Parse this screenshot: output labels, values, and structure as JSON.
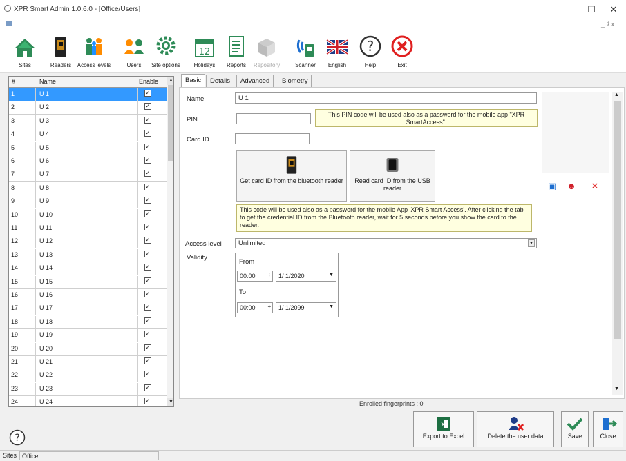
{
  "window": {
    "title": "XPR Smart Admin 1.0.6.0 - [Office/Users]",
    "min_glyph": "—",
    "max_glyph": "☐",
    "close_glyph": "✕",
    "mdi_controls": "_ ₫ x"
  },
  "toolbar": [
    {
      "key": "sites",
      "label": "Sites",
      "icon": "house-icon",
      "enabled": true
    },
    {
      "key": "readers",
      "label": "Readers",
      "icon": "reader-icon",
      "enabled": true
    },
    {
      "key": "access_levels",
      "label": "Access levels",
      "icon": "people-icon",
      "enabled": true
    },
    {
      "key": "users",
      "label": "Users",
      "icon": "users-icon",
      "enabled": true
    },
    {
      "key": "site_options",
      "label": "Site options",
      "icon": "gear-icon",
      "enabled": true
    },
    {
      "key": "holidays",
      "label": "Holidays",
      "icon": "calendar-icon",
      "enabled": true
    },
    {
      "key": "reports",
      "label": "Reports",
      "icon": "report-icon",
      "enabled": true
    },
    {
      "key": "repository",
      "label": "Repository",
      "icon": "repository-icon",
      "enabled": false
    },
    {
      "key": "scanner",
      "label": "Scanner",
      "icon": "scanner-icon",
      "enabled": true
    },
    {
      "key": "english",
      "label": "English",
      "icon": "uk-flag-icon",
      "enabled": true
    },
    {
      "key": "help",
      "label": "Help",
      "icon": "help-icon",
      "enabled": true
    },
    {
      "key": "exit",
      "label": "Exit",
      "icon": "exit-icon",
      "enabled": true
    }
  ],
  "users_grid": {
    "headers": {
      "id": "#",
      "name": "Name",
      "enable": "Enable"
    },
    "selected_index": 0,
    "rows": [
      {
        "id": "1",
        "name": "U 1",
        "enabled": true
      },
      {
        "id": "2",
        "name": "U 2",
        "enabled": true
      },
      {
        "id": "3",
        "name": "U 3",
        "enabled": true
      },
      {
        "id": "4",
        "name": "U 4",
        "enabled": true
      },
      {
        "id": "5",
        "name": "U 5",
        "enabled": true
      },
      {
        "id": "6",
        "name": "U 6",
        "enabled": true
      },
      {
        "id": "7",
        "name": "U 7",
        "enabled": true
      },
      {
        "id": "8",
        "name": "U 8",
        "enabled": true
      },
      {
        "id": "9",
        "name": "U 9",
        "enabled": true
      },
      {
        "id": "10",
        "name": "U 10",
        "enabled": true
      },
      {
        "id": "11",
        "name": "U 11",
        "enabled": true
      },
      {
        "id": "12",
        "name": "U 12",
        "enabled": true
      },
      {
        "id": "13",
        "name": "U 13",
        "enabled": true
      },
      {
        "id": "14",
        "name": "U 14",
        "enabled": true
      },
      {
        "id": "15",
        "name": "U 15",
        "enabled": true
      },
      {
        "id": "16",
        "name": "U 16",
        "enabled": true
      },
      {
        "id": "17",
        "name": "U 17",
        "enabled": true
      },
      {
        "id": "18",
        "name": "U 18",
        "enabled": true
      },
      {
        "id": "19",
        "name": "U 19",
        "enabled": true
      },
      {
        "id": "20",
        "name": "U 20",
        "enabled": true
      },
      {
        "id": "21",
        "name": "U 21",
        "enabled": true
      },
      {
        "id": "22",
        "name": "U 22",
        "enabled": true
      },
      {
        "id": "23",
        "name": "U 23",
        "enabled": true
      },
      {
        "id": "24",
        "name": "U 24",
        "enabled": true
      }
    ]
  },
  "tabs": [
    "Basic",
    "Details",
    "Advanced",
    "Biometry"
  ],
  "active_tab": 0,
  "form": {
    "name_label": "Name",
    "name_value": "U 1",
    "pin_label": "PIN",
    "pin_value": "",
    "pin_note": "This PIN code will be used also as a password for the mobile app \"XPR SmartAccess\".",
    "card_label": "Card ID",
    "card_value": "",
    "bt_button": "Get card ID from the bluetooth reader",
    "usb_button": "Read card ID from the USB reader",
    "card_note": "This code will be used also as a password for the mobile App 'XPR Smart Access'. After clicking the tab to get the credential ID from the Bluetooth reader, wait for 5 seconds before you show the card to the reader.",
    "access_label": "Access level",
    "access_value": "Unlimited",
    "validity_label": "Validity",
    "from_label": "From",
    "from_time": "00:00",
    "from_date": "1/ 1/2020",
    "to_label": "To",
    "to_time": "00:00",
    "to_date": "1/ 1/2099"
  },
  "enrolled": "Enrolled fingerprints : 0",
  "actions": {
    "excel": "Export to Excel",
    "delete": "Delete the user data",
    "save": "Save",
    "close": "Close"
  },
  "statusbar": {
    "sites_label": "Sites",
    "site_value": "Office"
  },
  "colors": {
    "selection": "#3399ff",
    "note_bg": "#ffffe0",
    "danger": "#e02020"
  }
}
